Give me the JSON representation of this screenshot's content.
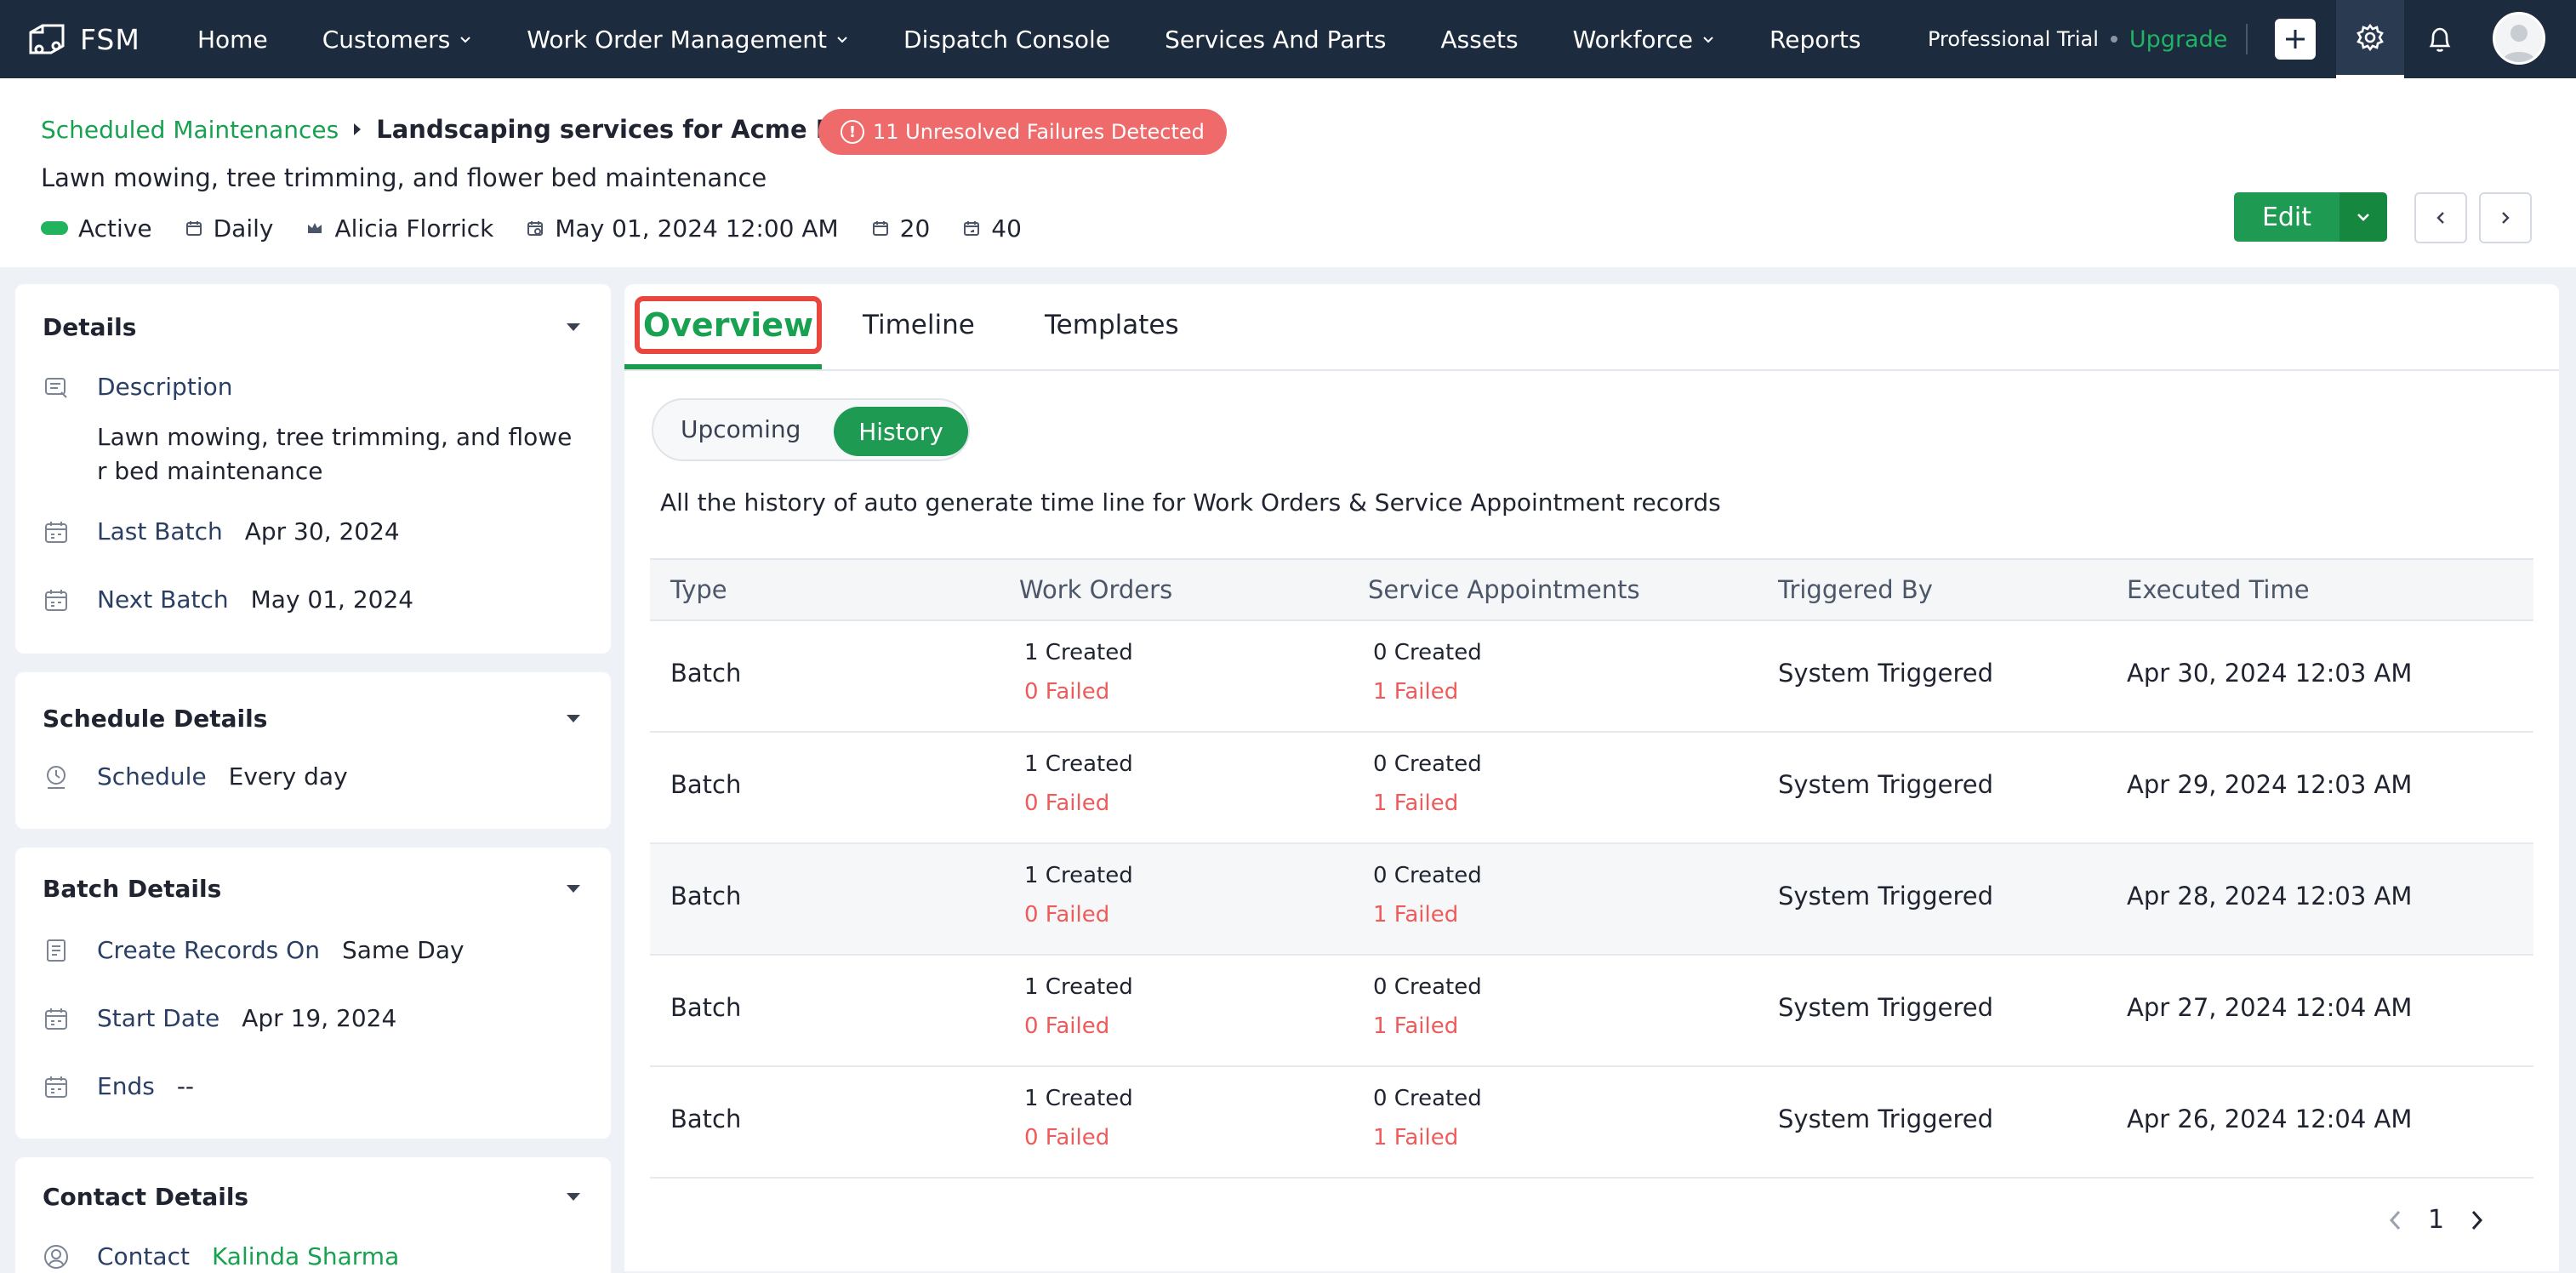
{
  "app": {
    "name": "FSM"
  },
  "nav": [
    {
      "label": "Home",
      "dropdown": false
    },
    {
      "label": "Customers",
      "dropdown": true
    },
    {
      "label": "Work Order Management",
      "dropdown": true
    },
    {
      "label": "Dispatch Console",
      "dropdown": false
    },
    {
      "label": "Services And Parts",
      "dropdown": false
    },
    {
      "label": "Assets",
      "dropdown": false
    },
    {
      "label": "Workforce",
      "dropdown": true
    },
    {
      "label": "Reports",
      "dropdown": false
    }
  ],
  "trial": {
    "plan": "Professional Trial",
    "upgrade": "Upgrade"
  },
  "header": {
    "breadcrumb_link": "Scheduled Maintenances",
    "title": "Landscaping services for Acme Inc.",
    "failure_badge": "11 Unresolved Failures Detected",
    "subtitle": "Lawn mowing, tree trimming, and flower bed maintenance",
    "status": "Active",
    "frequency": "Daily",
    "owner": "Alicia Florrick",
    "start": "May 01, 2024 12:00 AM",
    "count_a": "20",
    "count_b": "40",
    "edit_label": "Edit"
  },
  "sidebar": {
    "details": {
      "title": "Details",
      "description_label": "Description",
      "description_line1": "Lawn mowing, tree trimming, and flowe",
      "description_line2": "r bed maintenance",
      "last_batch_label": "Last Batch",
      "last_batch": "Apr 30, 2024",
      "next_batch_label": "Next Batch",
      "next_batch": "May 01, 2024"
    },
    "schedule": {
      "title": "Schedule Details",
      "schedule_label": "Schedule",
      "schedule_value": "Every day"
    },
    "batch": {
      "title": "Batch Details",
      "create_label": "Create Records On",
      "create_value": "Same Day",
      "start_label": "Start Date",
      "start_value": "Apr 19, 2024",
      "ends_label": "Ends",
      "ends_value": "--"
    },
    "contact": {
      "title": "Contact Details",
      "contact_label": "Contact",
      "contact_value": "Kalinda Sharma"
    }
  },
  "tabs": {
    "overview": "Overview",
    "timeline": "Timeline",
    "templates": "Templates"
  },
  "toggle": {
    "upcoming": "Upcoming",
    "history": "History"
  },
  "history_desc": "All the history of auto generate time line for Work Orders & Service Appointment records",
  "table": {
    "headers": {
      "type": "Type",
      "wo": "Work Orders",
      "sa": "Service Appointments",
      "trig": "Triggered By",
      "exec": "Executed Time"
    },
    "rows": [
      {
        "type": "Batch",
        "wo_created": "1 Created",
        "wo_failed": "0 Failed",
        "sa_created": "0 Created",
        "sa_failed": "1 Failed",
        "trig": "System Triggered",
        "exec": "Apr 30, 2024 12:03 AM"
      },
      {
        "type": "Batch",
        "wo_created": "1 Created",
        "wo_failed": "0 Failed",
        "sa_created": "0 Created",
        "sa_failed": "1 Failed",
        "trig": "System Triggered",
        "exec": "Apr 29, 2024 12:03 AM"
      },
      {
        "type": "Batch",
        "wo_created": "1 Created",
        "wo_failed": "0 Failed",
        "sa_created": "0 Created",
        "sa_failed": "1 Failed",
        "trig": "System Triggered",
        "exec": "Apr 28, 2024 12:03 AM"
      },
      {
        "type": "Batch",
        "wo_created": "1 Created",
        "wo_failed": "0 Failed",
        "sa_created": "0 Created",
        "sa_failed": "1 Failed",
        "trig": "System Triggered",
        "exec": "Apr 27, 2024 12:04 AM"
      },
      {
        "type": "Batch",
        "wo_created": "1 Created",
        "wo_failed": "0 Failed",
        "sa_created": "0 Created",
        "sa_failed": "1 Failed",
        "trig": "System Triggered",
        "exec": "Apr 26, 2024 12:04 AM"
      }
    ]
  },
  "pagination": {
    "page": "1"
  },
  "colors": {
    "accent": "#18a150",
    "topbar": "#1d2b3e",
    "danger": "#ee5b5b",
    "highlight": "#e8463f"
  }
}
